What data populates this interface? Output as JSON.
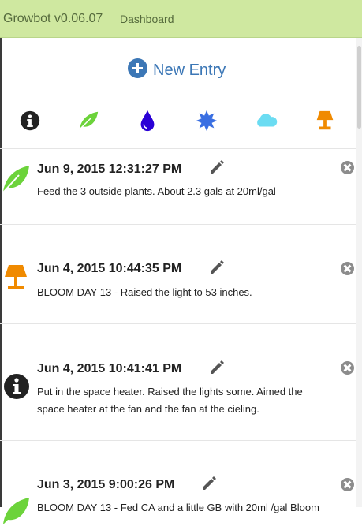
{
  "navbar": {
    "brand": "Growbot v0.06.07",
    "dashboard_link": "Dashboard"
  },
  "new_entry": {
    "label": "New Entry",
    "icon": "plus-circle-icon"
  },
  "filters": [
    {
      "name": "info",
      "icon": "info-circle-icon",
      "color": "#222222"
    },
    {
      "name": "feed",
      "icon": "leaf-icon",
      "color": "#6cd33b"
    },
    {
      "name": "water",
      "icon": "water-drop-icon",
      "color": "#2a00d6"
    },
    {
      "name": "nutrient",
      "icon": "star-burst-icon",
      "color": "#3a6fe2"
    },
    {
      "name": "air",
      "icon": "cloud-icon",
      "color": "#6bdcf2"
    },
    {
      "name": "light",
      "icon": "lamp-icon",
      "color": "#f08a00"
    }
  ],
  "entries": [
    {
      "icon": "leaf-icon",
      "timestamp": "Jun 9, 2015 12:31:27 PM",
      "text": "Feed the 3 outside plants. About 2.3 gals at 20ml/gal"
    },
    {
      "icon": "lamp-icon",
      "timestamp": "Jun 4, 2015 10:44:35 PM",
      "text": "BLOOM DAY 13 - Raised the light to 53 inches."
    },
    {
      "icon": "info-circle-icon",
      "timestamp": "Jun 4, 2015 10:41:41 PM",
      "text": "Put in the space heater. Raised the lights some. Aimed the space heater at the fan and the fan at the cieling."
    },
    {
      "icon": "leaf-icon",
      "timestamp": "Jun 3, 2015 9:00:26 PM",
      "text": "BLOOM DAY 13 - Fed CA and a little GB with 20ml /gal Bloom"
    }
  ],
  "action_icons": {
    "edit": "pencil-icon",
    "delete": "close-circle-icon"
  }
}
